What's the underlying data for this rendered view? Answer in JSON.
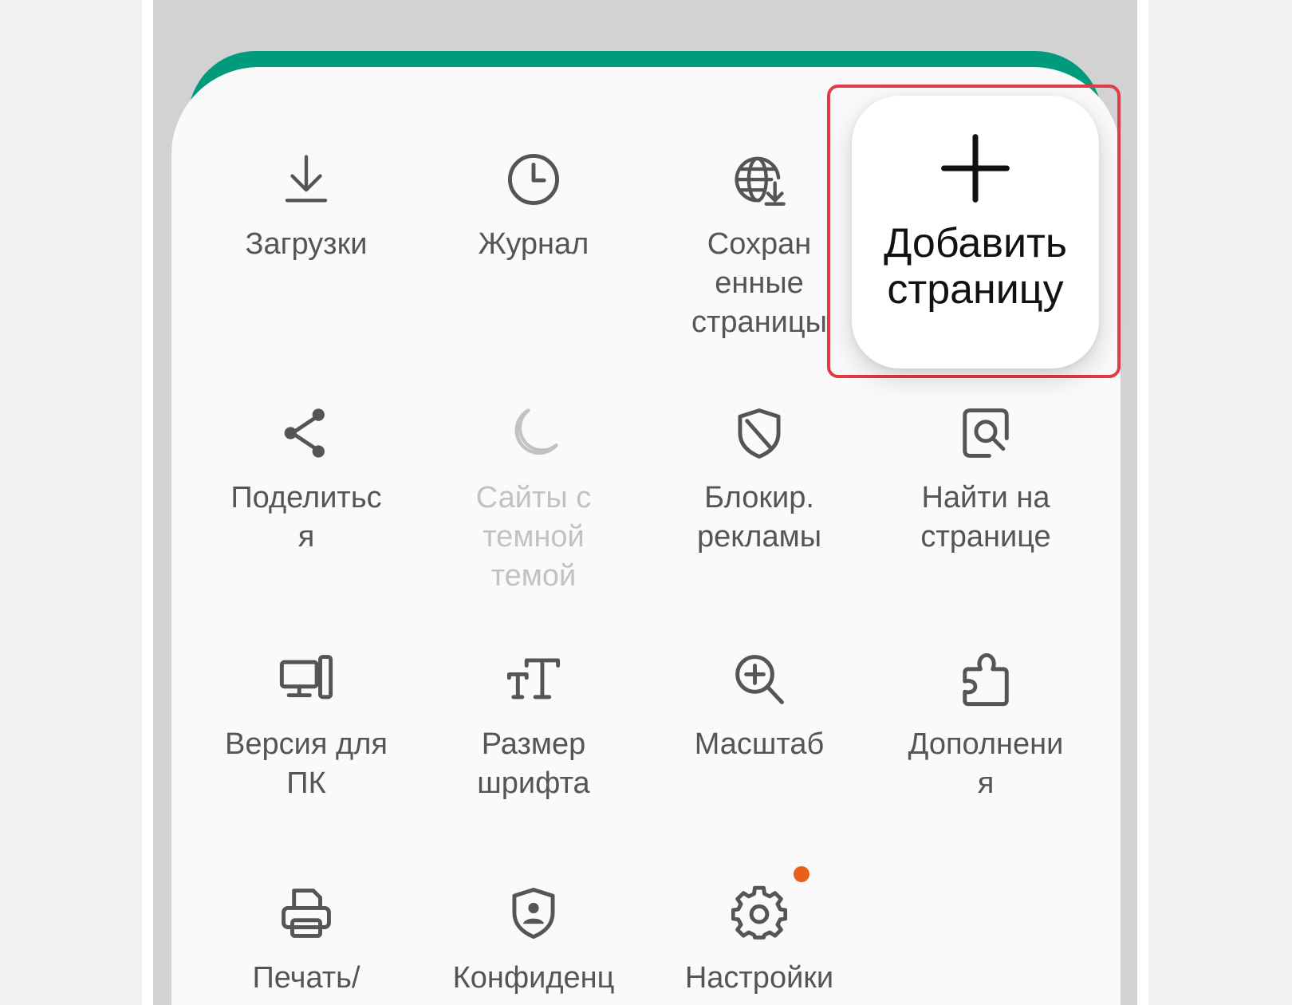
{
  "menu": {
    "items": [
      {
        "label": "Загрузки",
        "icon": "download-icon",
        "enabled": true
      },
      {
        "label": "Журнал",
        "icon": "history-clock-icon",
        "enabled": true
      },
      {
        "label": "Сохран\nенные\nстраницы",
        "icon": "saved-pages-globe-icon",
        "enabled": true
      },
      {
        "label": "Поделитьс\nя",
        "icon": "share-icon",
        "enabled": true
      },
      {
        "label": "Сайты с\nтемной\nтемой",
        "icon": "dark-mode-moon-icon",
        "enabled": false
      },
      {
        "label": "Блокир.\nрекламы",
        "icon": "ad-block-shield-icon",
        "enabled": true
      },
      {
        "label": "Найти на\nстранице",
        "icon": "find-on-page-icon",
        "enabled": true
      },
      {
        "label": "Версия для\nПК",
        "icon": "desktop-version-icon",
        "enabled": true
      },
      {
        "label": "Размер\nшрифта",
        "icon": "font-size-icon",
        "enabled": true
      },
      {
        "label": "Масштаб",
        "icon": "zoom-icon",
        "enabled": true
      },
      {
        "label": "Дополнени\nя",
        "icon": "extensions-puzzle-icon",
        "enabled": true
      },
      {
        "label": "Печать/",
        "icon": "print-icon",
        "enabled": true
      },
      {
        "label": "Конфиденц",
        "icon": "privacy-shield-icon",
        "enabled": true
      },
      {
        "label": "Настройки",
        "icon": "settings-gear-icon",
        "enabled": true,
        "notification_dot": true
      }
    ],
    "add_page": {
      "label": "Добавить\nстраницу",
      "icon": "plus-icon"
    }
  },
  "colors": {
    "accent": "#009b7d",
    "highlight_border": "#e33a44",
    "notification_dot": "#e8601a",
    "icon_text": "#555555",
    "disabled_text": "#c2c2c2"
  }
}
